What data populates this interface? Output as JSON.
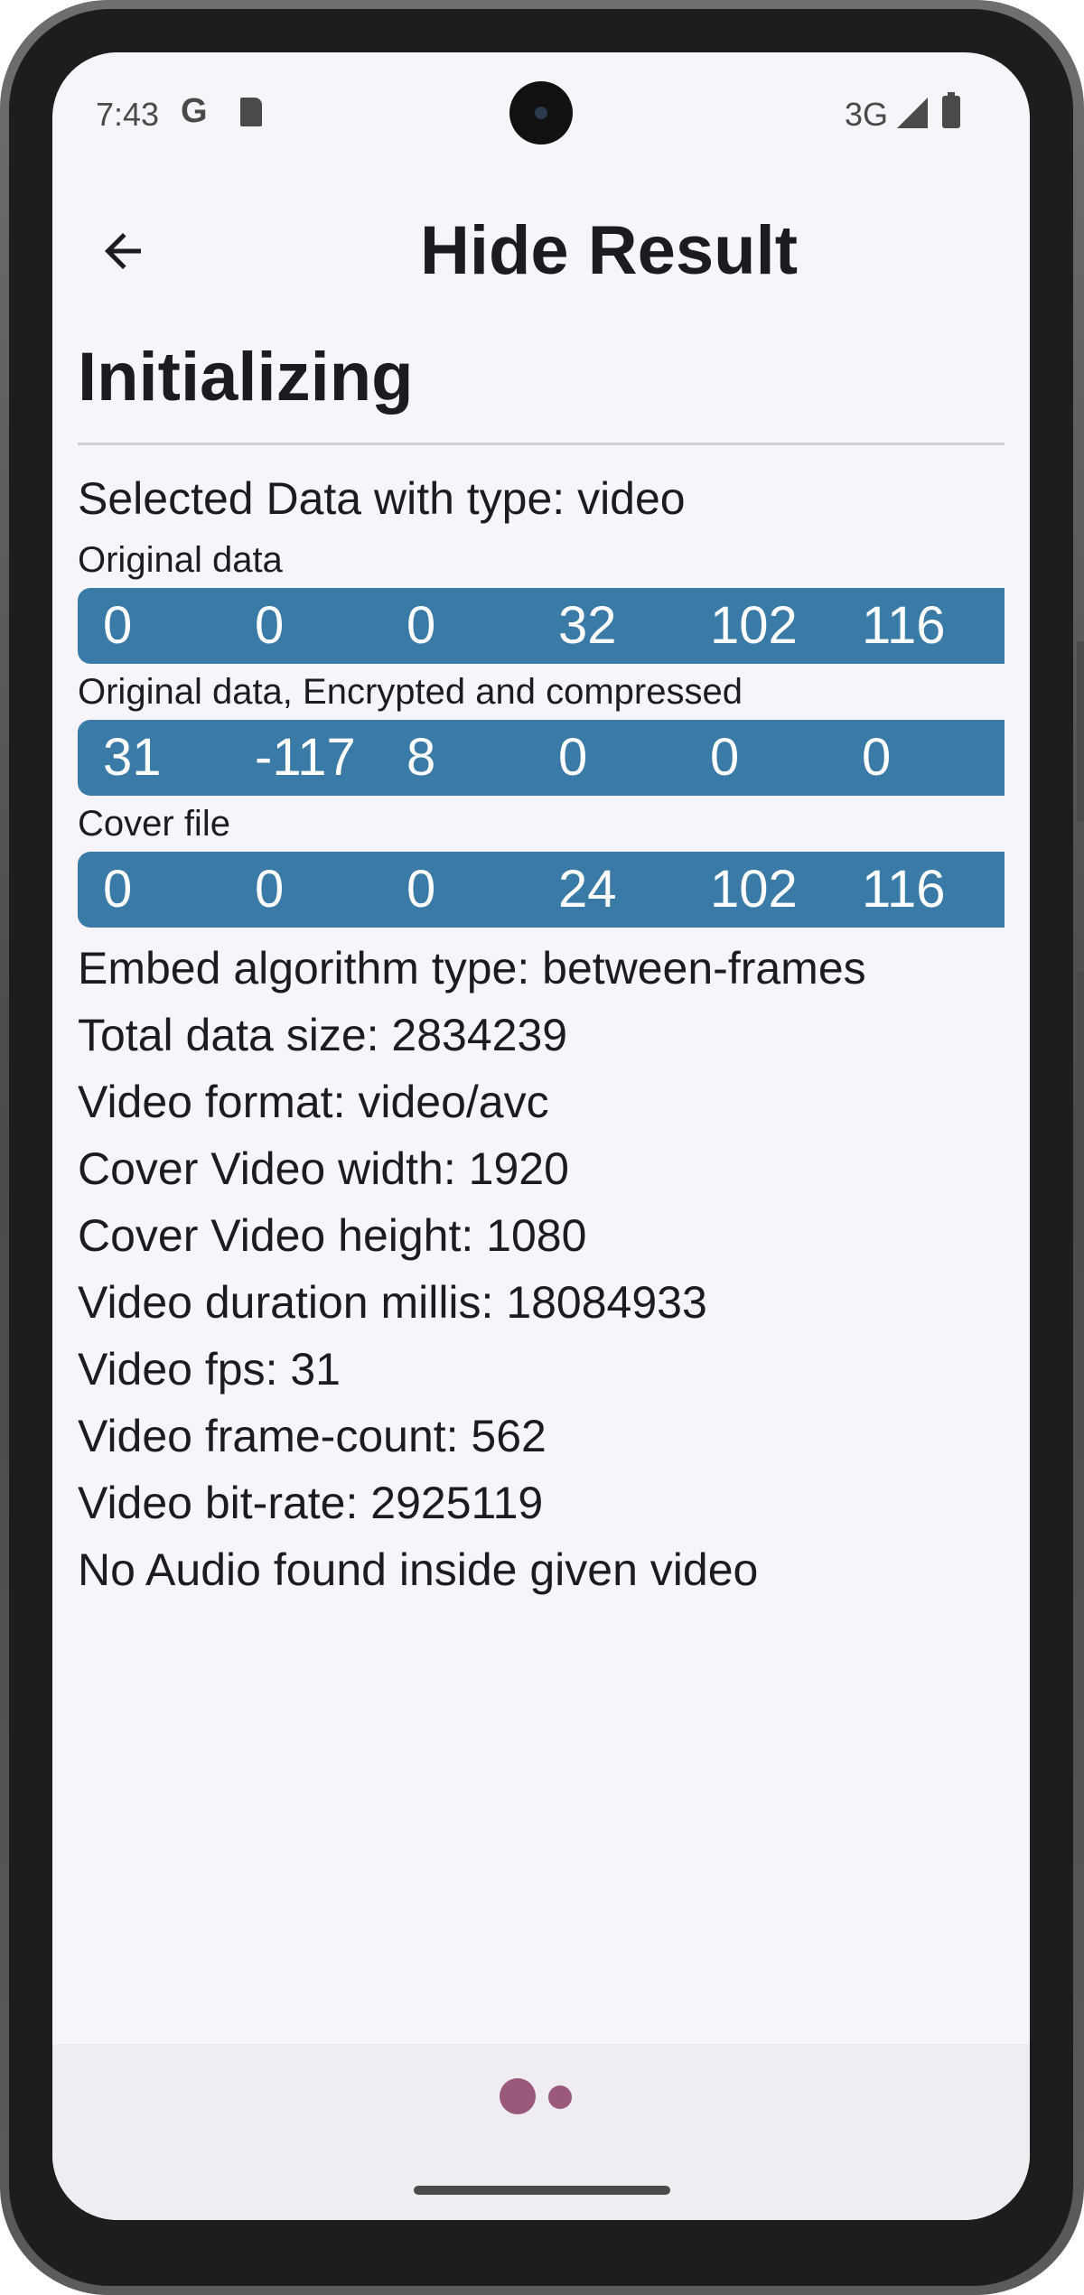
{
  "status_bar": {
    "time": "7:43",
    "google_icon": "G",
    "network": "3G"
  },
  "header": {
    "title": "Hide Result"
  },
  "main": {
    "status": "Initializing",
    "selected_data": "Selected Data with type: video",
    "original_data": {
      "caption": "Original data",
      "bytes": [
        "0",
        "0",
        "0",
        "32",
        "102",
        "116"
      ]
    },
    "encrypted_data": {
      "caption": "Original data, Encrypted and compressed",
      "bytes": [
        "31",
        "-117",
        "8",
        "0",
        "0",
        "0"
      ]
    },
    "cover_file": {
      "caption": "Cover file",
      "bytes": [
        "0",
        "0",
        "0",
        "24",
        "102",
        "116"
      ]
    },
    "info_lines": [
      "Embed algorithm type: between-frames",
      "Total data size: 2834239",
      "Video format: video/avc",
      "Cover Video width: 1920",
      "Cover Video height: 1080",
      "Video duration millis: 18084933",
      "Video fps: 31",
      "Video frame-count: 562",
      "Video bit-rate: 2925119",
      "No Audio found inside given video"
    ]
  },
  "colors": {
    "byte_strip": "#3a7aa6",
    "loading_dots": "#9a587a",
    "background": "#f7f5fa"
  }
}
